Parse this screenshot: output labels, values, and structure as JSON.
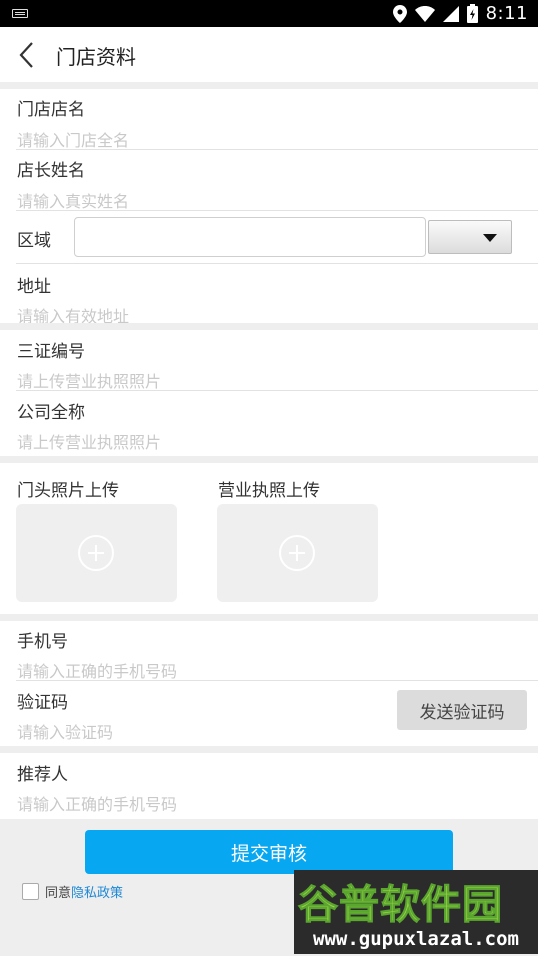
{
  "status_bar": {
    "time": "8:11",
    "icons": [
      "keyboard-icon",
      "location-icon",
      "wifi-icon",
      "signal-icon",
      "battery-icon"
    ]
  },
  "header": {
    "title": "门店资料",
    "back_icon": "chevron-left-icon"
  },
  "form": {
    "store_name": {
      "label": "门店店名",
      "placeholder": "请输入门店全名"
    },
    "manager_name": {
      "label": "店长姓名",
      "placeholder": "请输入真实姓名"
    },
    "region": {
      "label": "区域",
      "value": ""
    },
    "address": {
      "label": "地址",
      "placeholder": "请输入有效地址"
    },
    "license_number": {
      "label": "三证编号",
      "placeholder": "请上传营业执照照片"
    },
    "company_name": {
      "label": "公司全称",
      "placeholder": "请上传营业执照照片"
    },
    "uploads": [
      {
        "label": "门头照片上传",
        "icon": "plus-circle-icon"
      },
      {
        "label": "营业执照上传",
        "icon": "plus-circle-icon"
      }
    ],
    "phone": {
      "label": "手机号",
      "placeholder": "请输入正确的手机号码"
    },
    "verify_code": {
      "label": "验证码",
      "placeholder": "请输入验证码",
      "send_button": "发送验证码"
    },
    "referrer": {
      "label": "推荐人",
      "placeholder": "请输入正确的手机号码"
    }
  },
  "footer": {
    "submit_label": "提交审核",
    "agree_text": "同意",
    "policy_link": "隐私政策"
  },
  "watermark": {
    "logo_text": "谷普软件园",
    "url": "www.gupuxlazal.com"
  },
  "colors": {
    "primary": "#08a7f2",
    "link": "#1e88d6",
    "placeholder": "#c9c9c9",
    "separator": "#eeeeee"
  }
}
